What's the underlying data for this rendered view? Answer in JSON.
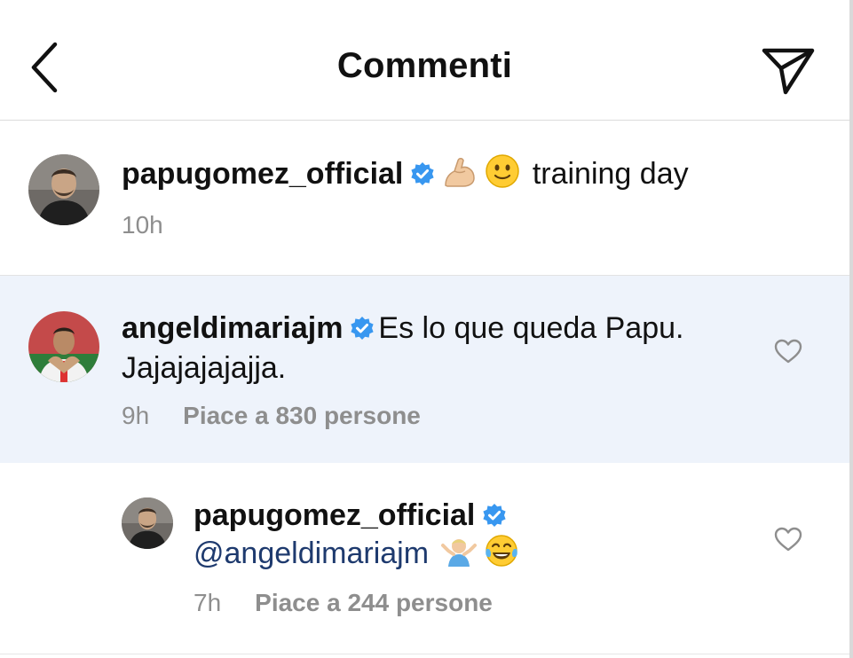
{
  "header": {
    "title": "Commenti",
    "back_icon": "chevron-left-icon",
    "send_icon": "paper-plane-icon"
  },
  "caption": {
    "username": "papugomez_official",
    "verified": true,
    "emojis": [
      "flexed-biceps-emoji",
      "slightly-smiling-face-emoji"
    ],
    "text": "training day",
    "time": "10h"
  },
  "comments": [
    {
      "username": "angeldimariajm",
      "verified": true,
      "text_line1": "Es lo que queda Papu.",
      "text_line2": "Jajajajajajja.",
      "time": "9h",
      "likes": "Piace a 830 persone",
      "highlighted": true
    }
  ],
  "reply": {
    "username": "papugomez_official",
    "verified": true,
    "mention": "@angeldimariajm",
    "emojis": [
      "person-shrugging-emoji",
      "face-with-tears-of-joy-emoji"
    ],
    "time": "7h",
    "likes": "Piace a 244 persone"
  },
  "colors": {
    "verified_blue": "#3897f0",
    "meta_gray": "#8e8e8e",
    "highlight_bg": "#eef3fb",
    "mention_blue": "#1e3a6e"
  }
}
